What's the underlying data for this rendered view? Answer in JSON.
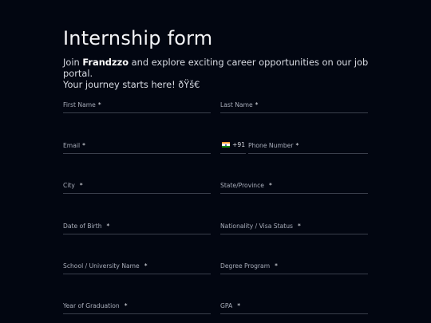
{
  "form": {
    "title": "Internship form",
    "intro_prefix": "Join ",
    "brand": "Frandzzo",
    "intro_line1_rest": " and explore exciting career opportunities on our job portal.",
    "intro_line2": "Your journey starts here! ðŸš€",
    "required_mark": "*",
    "fields": {
      "first_name": "First Name",
      "last_name": "Last Name",
      "email": "Email",
      "phone_code": "+91",
      "phone_number": "Phone Number",
      "city": "City",
      "state": "State/Province",
      "dob": "Date of Birth",
      "nationality": "Nationality / Visa Status",
      "school": "School / University Name",
      "degree": "Degree Program",
      "grad_year": "Year of Graduation",
      "gpa": "GPA"
    },
    "phone_flag_icon": "india-flag-icon"
  }
}
